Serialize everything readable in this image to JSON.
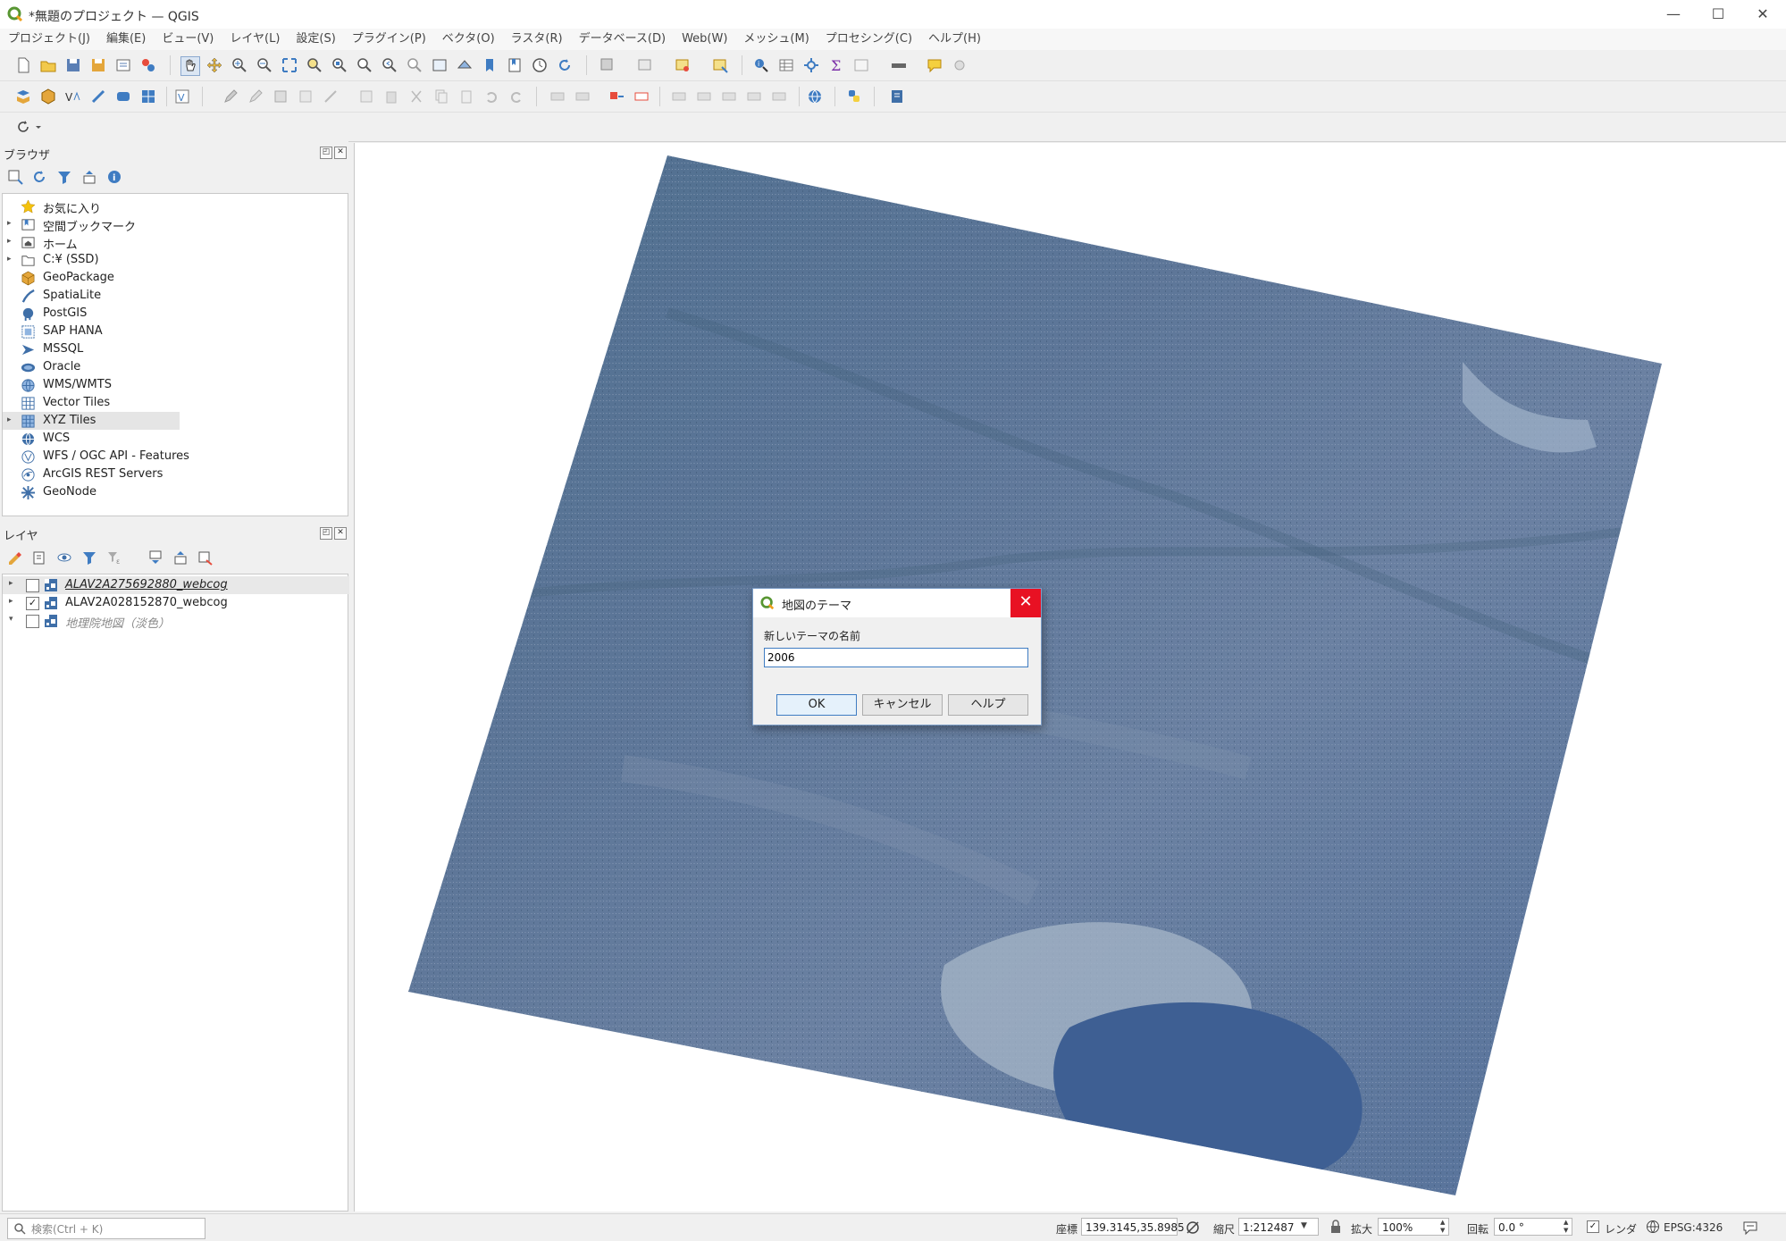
{
  "window": {
    "title": "*無題のプロジェクト — QGIS",
    "minimize": "—",
    "maximize": "☐",
    "close": "✕"
  },
  "menu": [
    "プロジェクト(J)",
    "編集(E)",
    "ビュー(V)",
    "レイヤ(L)",
    "設定(S)",
    "プラグイン(P)",
    "ベクタ(O)",
    "ラスタ(R)",
    "データベース(D)",
    "Web(W)",
    "メッシュ(M)",
    "プロセシング(C)",
    "ヘルプ(H)"
  ],
  "browser": {
    "title": "ブラウザ",
    "items": [
      {
        "label": "お気に入り",
        "icon": "star-icon",
        "expandable": false
      },
      {
        "label": "空間ブックマーク",
        "icon": "bookmark-icon",
        "expandable": true
      },
      {
        "label": "ホーム",
        "icon": "home-folder-icon",
        "expandable": true
      },
      {
        "label": "C:¥ (SSD)",
        "icon": "folder-icon",
        "expandable": true
      },
      {
        "label": "GeoPackage",
        "icon": "geopackage-icon",
        "expandable": false
      },
      {
        "label": "SpatiaLite",
        "icon": "spatialite-icon",
        "expandable": false
      },
      {
        "label": "PostGIS",
        "icon": "postgis-icon",
        "expandable": false
      },
      {
        "label": "SAP HANA",
        "icon": "sap-hana-icon",
        "expandable": false
      },
      {
        "label": "MSSQL",
        "icon": "mssql-icon",
        "expandable": false
      },
      {
        "label": "Oracle",
        "icon": "oracle-icon",
        "expandable": false
      },
      {
        "label": "WMS/WMTS",
        "icon": "wms-icon",
        "expandable": false
      },
      {
        "label": "Vector Tiles",
        "icon": "vector-tiles-icon",
        "expandable": false
      },
      {
        "label": "XYZ Tiles",
        "icon": "xyz-tiles-icon",
        "expandable": true
      },
      {
        "label": "WCS",
        "icon": "wcs-icon",
        "expandable": false
      },
      {
        "label": "WFS / OGC API - Features",
        "icon": "wfs-icon",
        "expandable": false
      },
      {
        "label": "ArcGIS REST Servers",
        "icon": "arcgis-icon",
        "expandable": false
      },
      {
        "label": "GeoNode",
        "icon": "geonode-icon",
        "expandable": false
      }
    ]
  },
  "layers": {
    "title": "レイヤ",
    "items": [
      {
        "label": "ALAV2A275692880_webcog",
        "checked": false,
        "expand": "▸"
      },
      {
        "label": "ALAV2A028152870_webcog",
        "checked": true,
        "expand": "▸",
        "check_mark": "✓"
      },
      {
        "label": "地理院地図（淡色）",
        "checked": false,
        "expand": "▾"
      }
    ]
  },
  "dialog": {
    "title": "地図のテーマ",
    "label": "新しいテーマの名前",
    "value": "2006",
    "ok": "OK",
    "cancel": "キャンセル",
    "help": "ヘルプ",
    "close": "✕"
  },
  "statusbar": {
    "search_placeholder": "検索(Ctrl + K)",
    "coord_label": "座標",
    "coord_value": "139.3145,35.8985",
    "scale_label": "縮尺",
    "scale_value": "1:212487",
    "magnify_label": "拡大",
    "magnify_value": "100%",
    "rotation_label": "回転",
    "rotation_value": "0.0 °",
    "render_label": "レンダ",
    "render_checked": true,
    "render_check_mark": "✓",
    "crs": "EPSG:4326"
  },
  "colors": {
    "accent": "#e81123",
    "selection": "#cce8ff",
    "map_bg": "#ffffff",
    "satellite": "#5a7393"
  }
}
